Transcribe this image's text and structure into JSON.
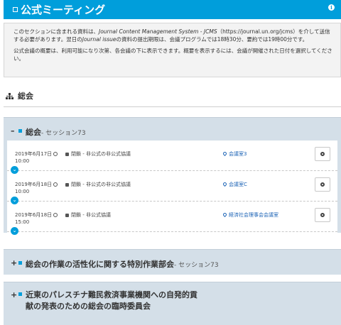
{
  "header": {
    "title": "公式ミーティング",
    "info_icon": "info-icon"
  },
  "notice": {
    "p1_a": "このセクションに含まれる資料は、",
    "p1_i1": "Journal Content Management System - JCMS",
    "p1_b": "（https://journal.un.org/jcms）を介して送信する必要があります。翌日の",
    "p1_i2": "Journal issue",
    "p1_c": "の資料の提出期限は、会議プログラムでは18時30分、要約では19時00分です。",
    "p2": "公式会議の概要は、利用可能になり次第、各会議の下に表示できます。概要を表示するには、会議が開催された日付を選択してください。"
  },
  "section": {
    "title": "総会"
  },
  "accordions": [
    {
      "toggle": "–",
      "title": "総会",
      "session": " - セッション73",
      "rows": [
        {
          "date": "2019年6月17日",
          "time": "10:00",
          "mode": "閉鎖 - 非公式の非公式協議",
          "room": "会議室3"
        },
        {
          "date": "2019年6月18日",
          "time": "10:00",
          "mode": "閉鎖 - 非公式の非公式協議",
          "room": "会議室C"
        },
        {
          "date": "2019年6月18日",
          "time": "15:00",
          "mode": "閉鎖 - 非公式協議",
          "room": "経済社会理事会会議室"
        }
      ]
    },
    {
      "toggle": "+",
      "title": "総会の作業の活性化に関する特別作業部会",
      "session": " - セッション73"
    },
    {
      "toggle": "+",
      "title": "近東のパレスチナ難民救済事業機関への自発的貢献の発表のための総会の臨時委員会",
      "session": ""
    }
  ],
  "colors": {
    "header_bg": "#009edb",
    "accordion_bg": "#d4dfe8",
    "link": "#1a62b5"
  }
}
